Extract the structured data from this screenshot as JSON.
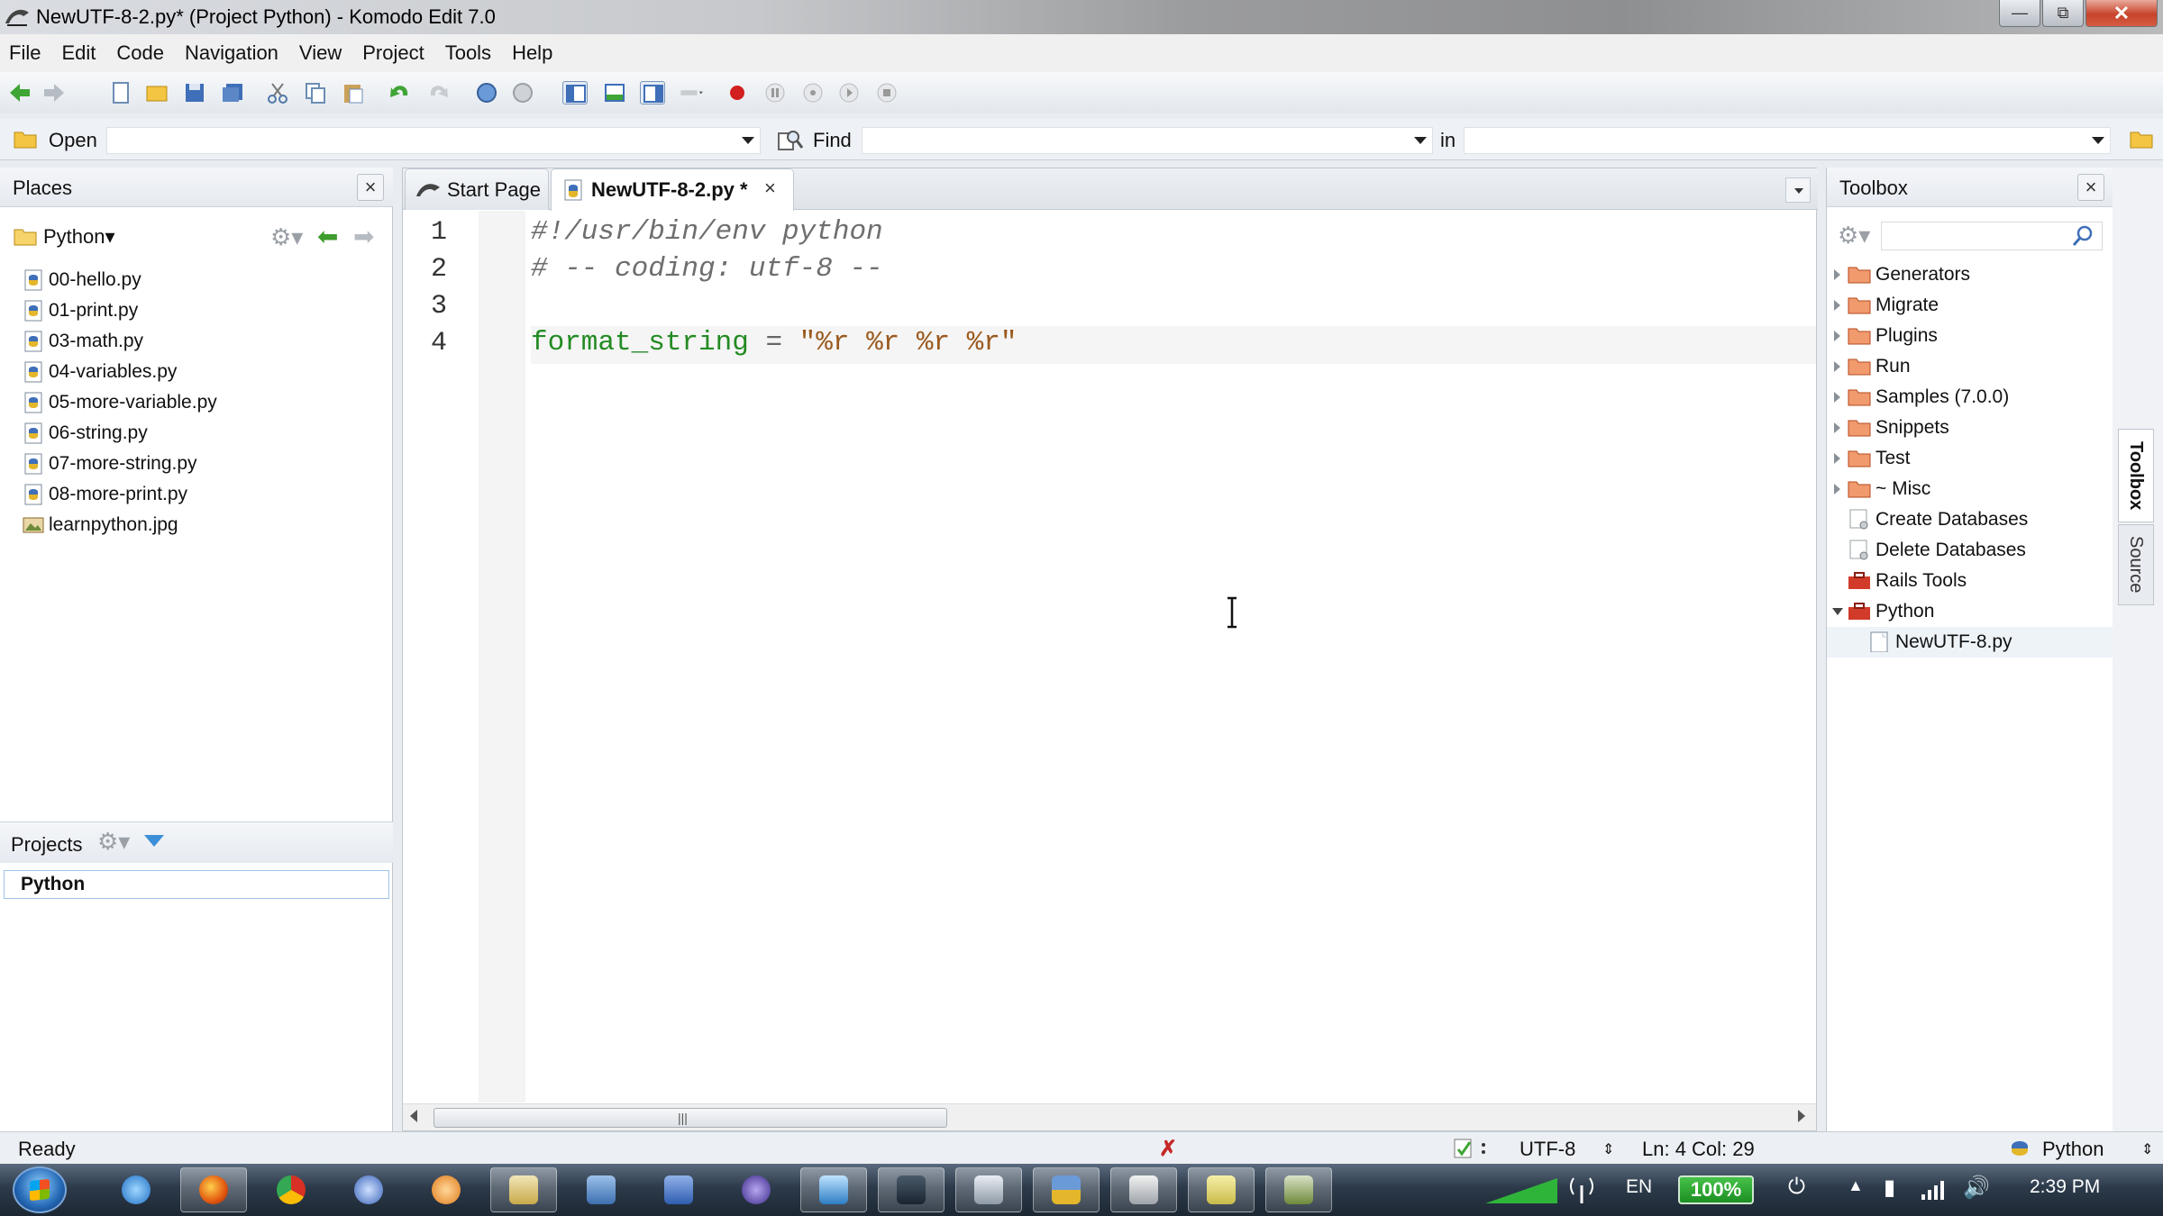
{
  "window": {
    "title": "NewUTF-8-2.py* (Project Python) - Komodo Edit 7.0",
    "minimize": "—",
    "maximize": "⧉",
    "close": "✕"
  },
  "menu": [
    "File",
    "Edit",
    "Code",
    "Navigation",
    "View",
    "Project",
    "Tools",
    "Help"
  ],
  "findbar": {
    "open_label": "Open",
    "find_label": "Find",
    "in_label": "in"
  },
  "places": {
    "title": "Places",
    "close": "×",
    "root": "Python",
    "files": [
      "00-hello.py",
      "01-print.py",
      "03-math.py",
      "04-variables.py",
      "05-more-variable.py",
      "06-string.py",
      "07-more-string.py",
      "08-more-print.py",
      "learnpython.jpg"
    ]
  },
  "projects": {
    "title": "Projects",
    "item": "Python"
  },
  "editor": {
    "tabs": [
      {
        "label": "Start Page"
      },
      {
        "label": "NewUTF-8-2.py *",
        "close": "×"
      }
    ],
    "line_numbers": [
      "1",
      "2",
      "3",
      "4"
    ],
    "lines": [
      {
        "text": "#!/usr/bin/env python"
      },
      {
        "text": "# -- coding: utf-8 --"
      },
      {
        "text": ""
      },
      {
        "ident": "format_string",
        "op": " = ",
        "str": "\"%r %r %r %r\""
      }
    ],
    "scroll_grip": "|||"
  },
  "toolbox": {
    "title": "Toolbox",
    "close": "×",
    "items": [
      {
        "label": "Generators",
        "type": "folder"
      },
      {
        "label": "Migrate",
        "type": "folder"
      },
      {
        "label": "Plugins",
        "type": "folder"
      },
      {
        "label": "Run",
        "type": "folder"
      },
      {
        "label": "Samples (7.0.0)",
        "type": "folder"
      },
      {
        "label": "Snippets",
        "type": "folder"
      },
      {
        "label": "Test",
        "type": "folder"
      },
      {
        "label": "~ Misc",
        "type": "folder"
      },
      {
        "label": "Create Databases",
        "type": "macro"
      },
      {
        "label": "Delete Databases",
        "type": "macro"
      },
      {
        "label": "Rails Tools",
        "type": "toolbox"
      },
      {
        "label": "Python",
        "type": "toolbox"
      },
      {
        "label": "NewUTF-8.py",
        "type": "file"
      }
    ]
  },
  "side_tabs": {
    "toolbox": "Toolbox",
    "source": "Source"
  },
  "status": {
    "state": "Ready",
    "encoding": "UTF-8",
    "position": "Ln: 4 Col: 29",
    "language": "Python"
  },
  "taskbar": {
    "lang": "EN",
    "battery": "100%",
    "time": "2:39 PM"
  },
  "colors": {
    "comment": "#6e6e6e",
    "identifier": "#238b23",
    "string": "#9a5a1e",
    "error_marker": "#c62828"
  }
}
